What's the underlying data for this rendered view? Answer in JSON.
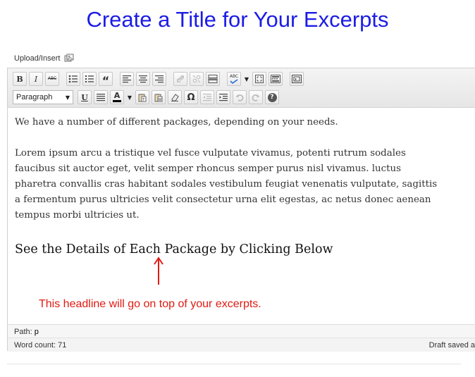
{
  "title": "Create a Title for Your Excerpts",
  "upload": {
    "label": "Upload/Insert"
  },
  "toolbar": {
    "bold": "B",
    "italic": "I",
    "strike": "ABC",
    "blockquote": "“",
    "spellcheck": "ABC",
    "kitchen_sink": "☰",
    "format_select": "Paragraph",
    "underline": "U",
    "text_color": "A",
    "special_char": "Ω",
    "help": "?"
  },
  "content": {
    "paragraph1": "We have a number of different packages, depending on your needs.",
    "paragraph2": "Lorem ipsum arcu a tristique vel fusce vulputate vivamus, potenti rutrum sodales faucibus sit auctor eget, velit semper rhoncus semper purus nisl vivamus. luctus pharetra convallis cras habitant sodales vestibulum feugiat venenatis vulputate, sagittis a fermentum purus ultricies velit consectetur urna elit egestas, ac netus donec aenean tempus morbi ultricies ut.",
    "headline": "See the Details of Each Package by Clicking Below",
    "annotation": "This headline will go on top of your excerpts."
  },
  "status": {
    "path_label": "Path:",
    "path_value": "p",
    "word_count_label": "Word count:",
    "word_count_value": "71",
    "draft_text": "Draft saved a"
  },
  "colors": {
    "title": "#1c1ce6",
    "annotation": "#e11a12"
  }
}
